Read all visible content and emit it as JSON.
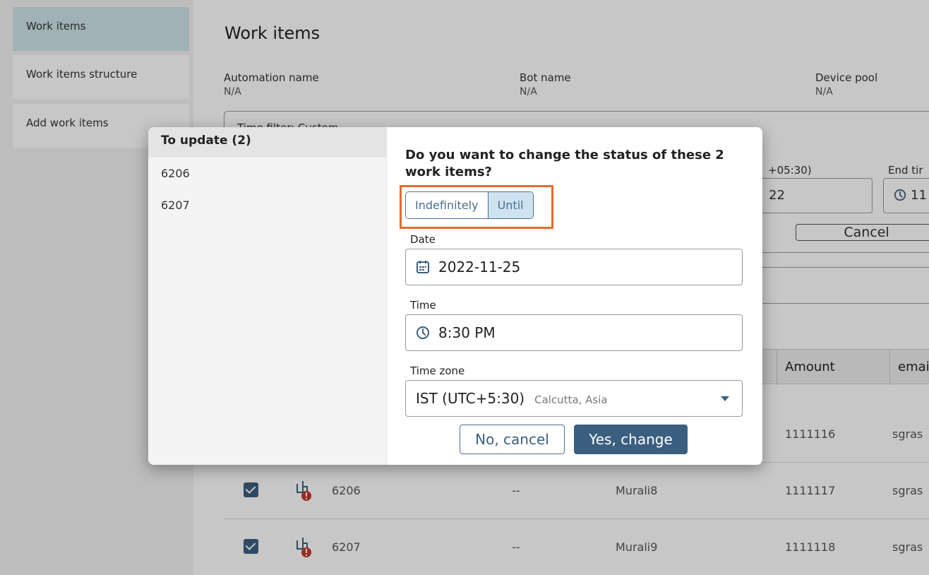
{
  "sidebar": {
    "items": [
      {
        "label": "Work items",
        "active": true
      },
      {
        "label": "Work items structure",
        "active": false
      },
      {
        "label": "Add work items",
        "active": false
      }
    ]
  },
  "main": {
    "title": "Work items",
    "meta": [
      {
        "label": "Automation name",
        "value": "N/A"
      },
      {
        "label": "Bot name",
        "value": "N/A"
      },
      {
        "label": "Device pool",
        "value": "N/A"
      }
    ],
    "filter": {
      "title": "Time filter: Custom",
      "timezone_partial": "+05:30)",
      "end_label_partial": "End tir",
      "date_value_partial": "22",
      "end_value_partial": "11",
      "cancel_label": "Cancel"
    },
    "table": {
      "headers": [
        "Amount",
        "emai"
      ],
      "rows": [
        {
          "checked": true,
          "id": "",
          "col1": "",
          "name": "",
          "amount": "1111116",
          "email": "sgras"
        },
        {
          "checked": true,
          "id": "6206",
          "col1": "--",
          "name": "Murali8",
          "amount": "1111117",
          "email": "sgras"
        },
        {
          "checked": true,
          "id": "6207",
          "col1": "--",
          "name": "Murali9",
          "amount": "1111118",
          "email": "sgras"
        }
      ]
    }
  },
  "modal": {
    "list_title": "To update (2)",
    "list_items": [
      "6206",
      "6207"
    ],
    "question": "Do you want to change the status of these 2 work items?",
    "toggle": {
      "options": [
        "Indefinitely",
        "Until"
      ],
      "selected": "Until"
    },
    "date": {
      "label": "Date",
      "value": "2022-11-25"
    },
    "time": {
      "label": "Time",
      "value": "8:30 PM"
    },
    "timezone": {
      "label": "Time zone",
      "value": "IST (UTC+5:30)",
      "subtext": "Calcutta, Asia"
    },
    "no_button": "No, cancel",
    "yes_button": "Yes, change"
  },
  "colors": {
    "accent": "#3b5f7f",
    "highlight": "#e86a2c",
    "active_nav": "#cfe4ea",
    "status_error": "#c0392b"
  }
}
